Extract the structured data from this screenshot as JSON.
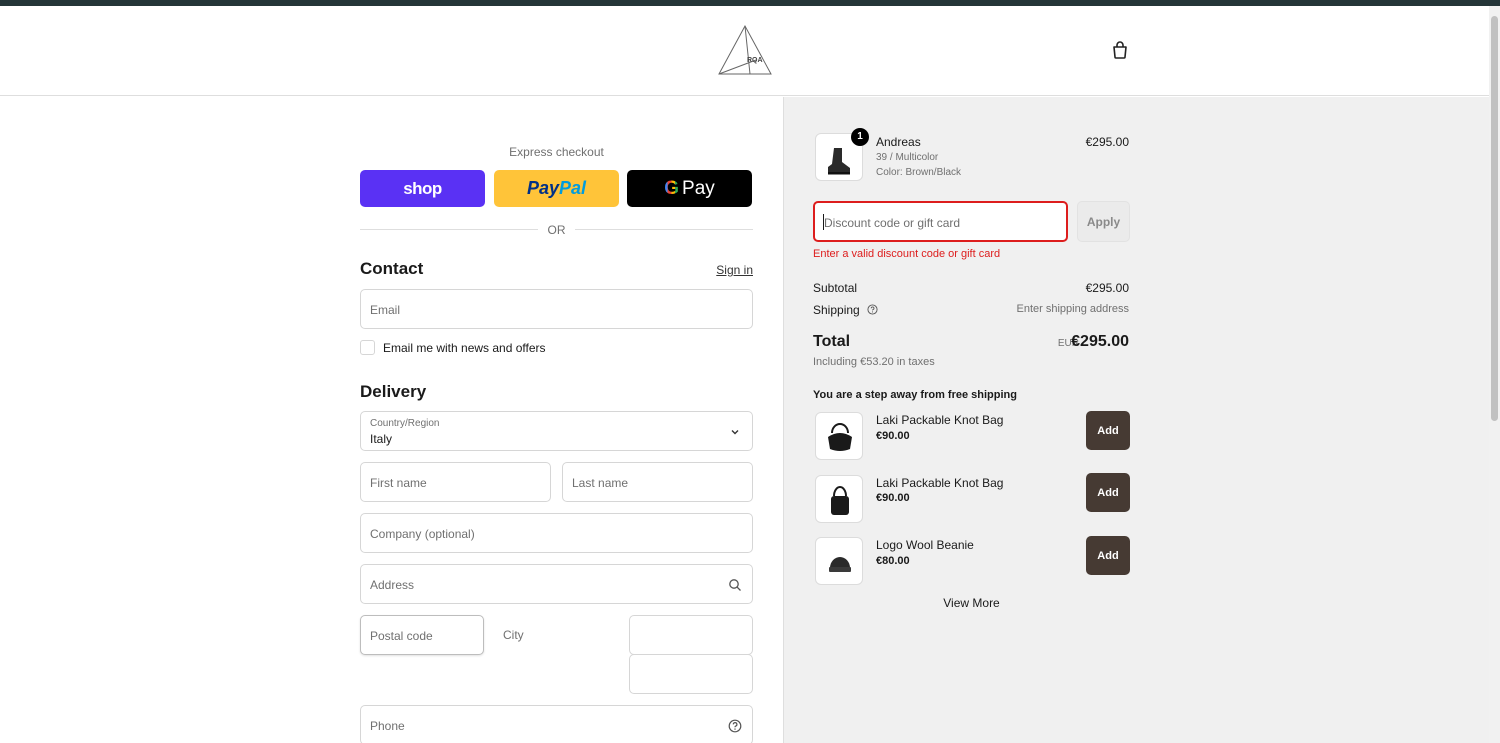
{
  "brand": {
    "logo_text": "RQA"
  },
  "express": {
    "label": "Express checkout",
    "shop_label": "shop",
    "paypal_part1": "Pay",
    "paypal_part2": "Pal",
    "gpay_g": "G",
    "gpay_label": "Pay",
    "or_label": "OR"
  },
  "contact": {
    "title": "Contact",
    "signin_label": "Sign in",
    "email_placeholder": "Email",
    "newsletter_label": "Email me with news and offers"
  },
  "delivery": {
    "title": "Delivery",
    "country_label": "Country/Region",
    "country_value": "Italy",
    "first_name_placeholder": "First name",
    "last_name_placeholder": "Last name",
    "company_placeholder": "Company (optional)",
    "address_placeholder": "Address",
    "postal_placeholder": "Postal code",
    "city_label": "City",
    "phone_placeholder": "Phone"
  },
  "summary": {
    "item": {
      "qty": "1",
      "name": "Andreas",
      "variant": "39 / Multicolor",
      "color": "Color: Brown/Black",
      "price": "€295.00"
    },
    "discount_placeholder": "Discount code or gift card",
    "apply_label": "Apply",
    "discount_error": "Enter a valid discount code or gift card",
    "subtotal_label": "Subtotal",
    "subtotal_value": "€295.00",
    "shipping_label": "Shipping",
    "shipping_value": "Enter shipping address",
    "total_label": "Total",
    "currency": "EUR",
    "total_value": "€295.00",
    "tax_note": "Including €53.20 in taxes"
  },
  "upsell": {
    "title": "You are a step away from free shipping",
    "add_label": "Add",
    "items": [
      {
        "name": "Laki Packable Knot Bag",
        "price": "€90.00"
      },
      {
        "name": "Laki Packable Knot Bag",
        "price": "€90.00"
      },
      {
        "name": "Logo Wool Beanie",
        "price": "€80.00"
      }
    ],
    "view_more_label": "View More"
  },
  "colors": {
    "shop": "#5a31f4",
    "paypal": "#ffc439",
    "gpay": "#000000",
    "error": "#dd1d1d",
    "add_button": "#463a33",
    "summary_bg": "#f0f0f0"
  }
}
